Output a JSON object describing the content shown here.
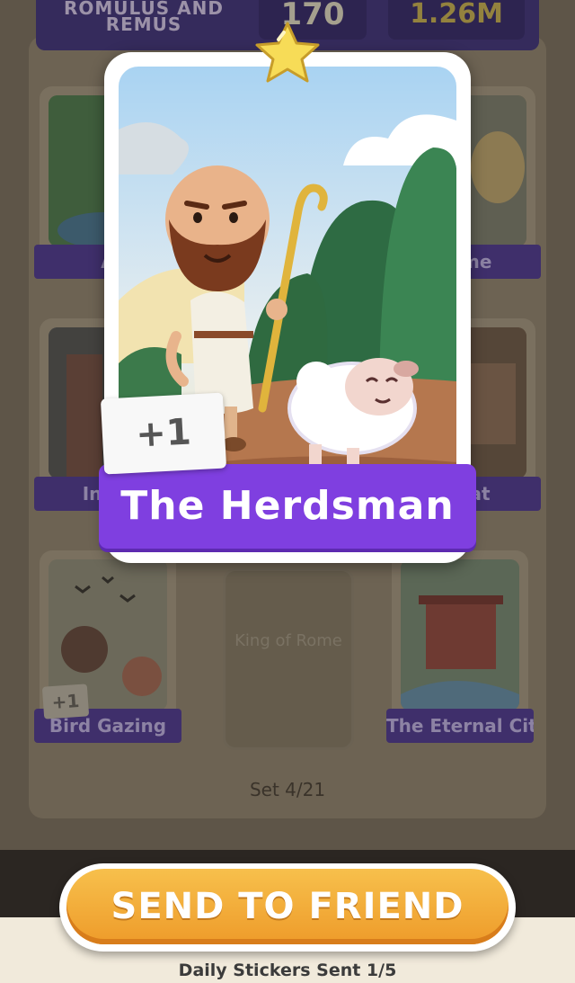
{
  "album": {
    "title": "ROMULUS AND REMUS",
    "count": "170",
    "prize": "1.26M",
    "set": "Set 4/21"
  },
  "background_stickers": [
    {
      "label": "A"
    },
    {
      "label": "Time"
    },
    {
      "label": "In Th"
    },
    {
      "label": "Seat"
    },
    {
      "label": "Bird Gazing",
      "badge": "+1"
    },
    {
      "label": "The Eternal City"
    }
  ],
  "empty_slot": {
    "label": "King of Rome"
  },
  "featured_card": {
    "name": "The Herdsman",
    "badge": "+1",
    "stars": 1,
    "star_icon": "star-icon"
  },
  "actions": {
    "send_label": "SEND TO FRIEND",
    "daily_status": "Daily Stickers Sent 1/5"
  },
  "colors": {
    "card_label": "#7f3fe0",
    "send_button": "#f2a936",
    "star": "#f7dc57"
  }
}
